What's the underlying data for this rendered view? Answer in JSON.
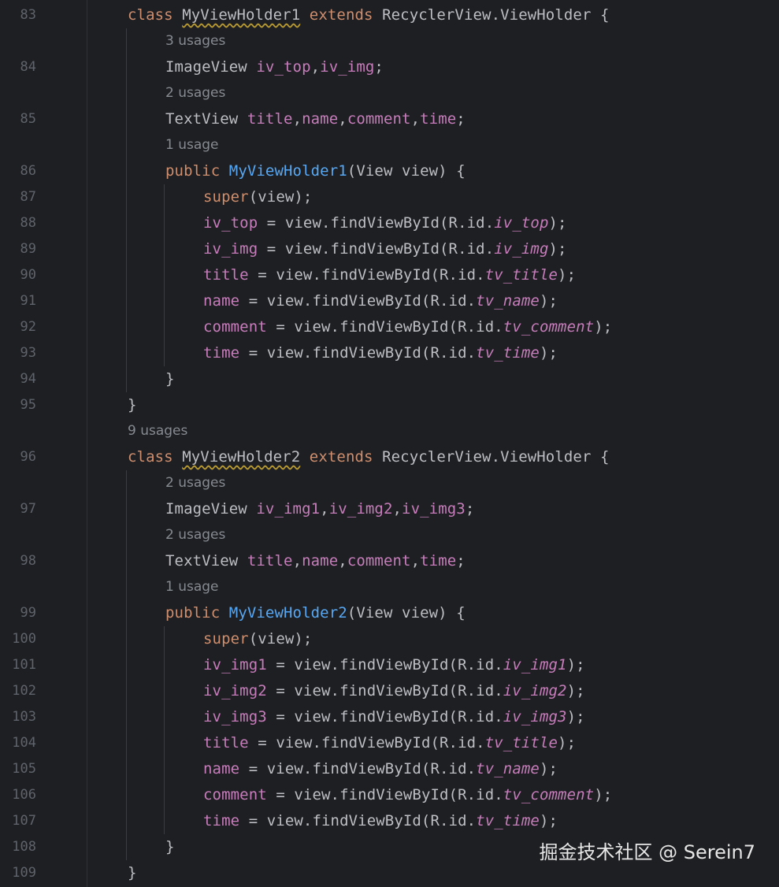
{
  "watermark": "掘金技术社区 @ Serein7",
  "lines": [
    {
      "kind": "code",
      "num": "83",
      "indent": 1,
      "tokens": [
        [
          "kw",
          "class "
        ],
        [
          "sq",
          "MyViewHolder1"
        ],
        [
          "kw",
          " extends "
        ],
        [
          "",
          "RecyclerView.ViewHolder {"
        ]
      ]
    },
    {
      "kind": "usage",
      "indent": 2,
      "text": "3 usages"
    },
    {
      "kind": "code",
      "num": "84",
      "indent": 2,
      "tokens": [
        [
          "",
          "ImageView "
        ],
        [
          "fld",
          "iv_top"
        ],
        [
          "",
          ","
        ],
        [
          "fld",
          "iv_img"
        ],
        [
          "",
          ";"
        ]
      ]
    },
    {
      "kind": "usage",
      "indent": 2,
      "text": "2 usages"
    },
    {
      "kind": "code",
      "num": "85",
      "indent": 2,
      "tokens": [
        [
          "",
          "TextView "
        ],
        [
          "fld",
          "title"
        ],
        [
          "",
          ","
        ],
        [
          "fld",
          "name"
        ],
        [
          "",
          ","
        ],
        [
          "fld",
          "comment"
        ],
        [
          "",
          ","
        ],
        [
          "fld",
          "time"
        ],
        [
          "",
          ";"
        ]
      ]
    },
    {
      "kind": "usage",
      "indent": 2,
      "text": "1 usage"
    },
    {
      "kind": "code",
      "num": "86",
      "indent": 2,
      "tokens": [
        [
          "kw",
          "public "
        ],
        [
          "fn",
          "MyViewHolder1"
        ],
        [
          "",
          "(View view) {"
        ]
      ]
    },
    {
      "kind": "code",
      "num": "87",
      "indent": 3,
      "tokens": [
        [
          "kw",
          "super"
        ],
        [
          "",
          "(view);"
        ]
      ]
    },
    {
      "kind": "code",
      "num": "88",
      "indent": 3,
      "tokens": [
        [
          "fld",
          "iv_top"
        ],
        [
          "",
          " = view.findViewById(R.id."
        ],
        [
          "it",
          "iv_top"
        ],
        [
          "",
          ");"
        ]
      ]
    },
    {
      "kind": "code",
      "num": "89",
      "indent": 3,
      "tokens": [
        [
          "fld",
          "iv_img"
        ],
        [
          "",
          " = view.findViewById(R.id."
        ],
        [
          "it",
          "iv_img"
        ],
        [
          "",
          ");"
        ]
      ]
    },
    {
      "kind": "code",
      "num": "90",
      "indent": 3,
      "tokens": [
        [
          "fld",
          "title"
        ],
        [
          "",
          " = view.findViewById(R.id."
        ],
        [
          "it",
          "tv_title"
        ],
        [
          "",
          ");"
        ]
      ]
    },
    {
      "kind": "code",
      "num": "91",
      "indent": 3,
      "tokens": [
        [
          "fld",
          "name"
        ],
        [
          "",
          " = view.findViewById(R.id."
        ],
        [
          "it",
          "tv_name"
        ],
        [
          "",
          ");"
        ]
      ]
    },
    {
      "kind": "code",
      "num": "92",
      "indent": 3,
      "tokens": [
        [
          "fld",
          "comment"
        ],
        [
          "",
          " = view.findViewById(R.id."
        ],
        [
          "it",
          "tv_comment"
        ],
        [
          "",
          ");"
        ]
      ]
    },
    {
      "kind": "code",
      "num": "93",
      "indent": 3,
      "tokens": [
        [
          "fld",
          "time"
        ],
        [
          "",
          " = view.findViewById(R.id."
        ],
        [
          "it",
          "tv_time"
        ],
        [
          "",
          ");"
        ]
      ]
    },
    {
      "kind": "code",
      "num": "94",
      "indent": 2,
      "tokens": [
        [
          "",
          "}"
        ]
      ]
    },
    {
      "kind": "code",
      "num": "95",
      "indent": 1,
      "tokens": [
        [
          "",
          "}"
        ]
      ]
    },
    {
      "kind": "usage",
      "indent": 1,
      "text": "9 usages"
    },
    {
      "kind": "code",
      "num": "96",
      "indent": 1,
      "tokens": [
        [
          "kw",
          "class "
        ],
        [
          "sq",
          "MyViewHolder2"
        ],
        [
          "kw",
          " extends "
        ],
        [
          "",
          "RecyclerView.ViewHolder {"
        ]
      ]
    },
    {
      "kind": "usage",
      "indent": 2,
      "text": "2 usages"
    },
    {
      "kind": "code",
      "num": "97",
      "indent": 2,
      "tokens": [
        [
          "",
          "ImageView "
        ],
        [
          "fld",
          "iv_img1"
        ],
        [
          "",
          ","
        ],
        [
          "fld",
          "iv_img2"
        ],
        [
          "",
          ","
        ],
        [
          "fld",
          "iv_img3"
        ],
        [
          "",
          ";"
        ]
      ]
    },
    {
      "kind": "usage",
      "indent": 2,
      "text": "2 usages"
    },
    {
      "kind": "code",
      "num": "98",
      "indent": 2,
      "tokens": [
        [
          "",
          "TextView "
        ],
        [
          "fld",
          "title"
        ],
        [
          "",
          ","
        ],
        [
          "fld",
          "name"
        ],
        [
          "",
          ","
        ],
        [
          "fld",
          "comment"
        ],
        [
          "",
          ","
        ],
        [
          "fld",
          "time"
        ],
        [
          "",
          ";"
        ]
      ]
    },
    {
      "kind": "usage",
      "indent": 2,
      "text": "1 usage"
    },
    {
      "kind": "code",
      "num": "99",
      "indent": 2,
      "tokens": [
        [
          "kw",
          "public "
        ],
        [
          "fn",
          "MyViewHolder2"
        ],
        [
          "",
          "(View view) {"
        ]
      ]
    },
    {
      "kind": "code",
      "num": "100",
      "indent": 3,
      "tokens": [
        [
          "kw",
          "super"
        ],
        [
          "",
          "(view);"
        ]
      ]
    },
    {
      "kind": "code",
      "num": "101",
      "indent": 3,
      "tokens": [
        [
          "fld",
          "iv_img1"
        ],
        [
          "",
          " = view.findViewById(R.id."
        ],
        [
          "it",
          "iv_img1"
        ],
        [
          "",
          ");"
        ]
      ]
    },
    {
      "kind": "code",
      "num": "102",
      "indent": 3,
      "tokens": [
        [
          "fld",
          "iv_img2"
        ],
        [
          "",
          " = view.findViewById(R.id."
        ],
        [
          "it",
          "iv_img2"
        ],
        [
          "",
          ");"
        ]
      ]
    },
    {
      "kind": "code",
      "num": "103",
      "indent": 3,
      "tokens": [
        [
          "fld",
          "iv_img3"
        ],
        [
          "",
          " = view.findViewById(R.id."
        ],
        [
          "it",
          "iv_img3"
        ],
        [
          "",
          ");"
        ]
      ]
    },
    {
      "kind": "code",
      "num": "104",
      "indent": 3,
      "tokens": [
        [
          "fld",
          "title"
        ],
        [
          "",
          " = view.findViewById(R.id."
        ],
        [
          "it",
          "tv_title"
        ],
        [
          "",
          ");"
        ]
      ]
    },
    {
      "kind": "code",
      "num": "105",
      "indent": 3,
      "tokens": [
        [
          "fld",
          "name"
        ],
        [
          "",
          " = view.findViewById(R.id."
        ],
        [
          "it",
          "tv_name"
        ],
        [
          "",
          ");"
        ]
      ]
    },
    {
      "kind": "code",
      "num": "106",
      "indent": 3,
      "tokens": [
        [
          "fld",
          "comment"
        ],
        [
          "",
          " = view.findViewById(R.id."
        ],
        [
          "it",
          "tv_comment"
        ],
        [
          "",
          ");"
        ]
      ]
    },
    {
      "kind": "code",
      "num": "107",
      "indent": 3,
      "tokens": [
        [
          "fld",
          "time"
        ],
        [
          "",
          " = view.findViewById(R.id."
        ],
        [
          "it",
          "tv_time"
        ],
        [
          "",
          ");"
        ]
      ]
    },
    {
      "kind": "code",
      "num": "108",
      "indent": 2,
      "tokens": [
        [
          "",
          "}"
        ]
      ]
    },
    {
      "kind": "code",
      "num": "109",
      "indent": 1,
      "tokens": [
        [
          "",
          "}"
        ]
      ]
    }
  ]
}
